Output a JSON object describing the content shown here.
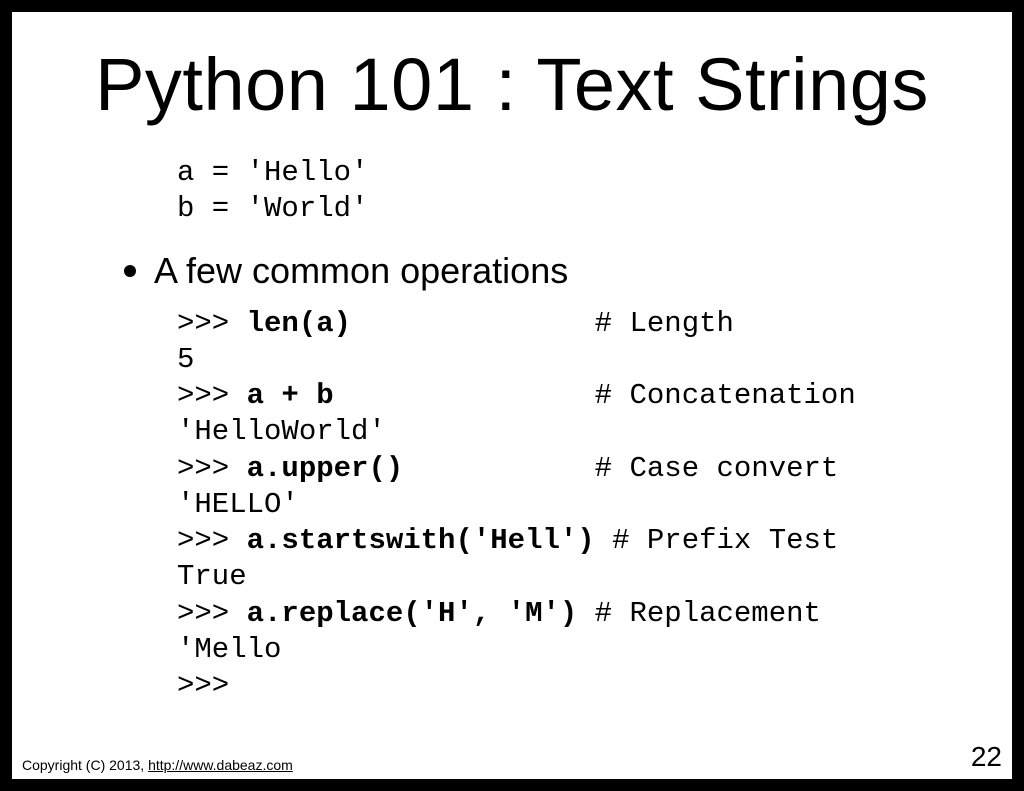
{
  "title": "Python 101 : Text Strings",
  "code_intro": "a = 'Hello'\nb = 'World'",
  "bullet": "A few common operations",
  "lines": [
    {
      "p": ">>> ",
      "b": "len(a)             ",
      "c": " # Length"
    },
    {
      "p": "5",
      "b": "",
      "c": ""
    },
    {
      "p": ">>> ",
      "b": "a + b              ",
      "c": " # Concatenation"
    },
    {
      "p": "'HelloWorld'",
      "b": "",
      "c": ""
    },
    {
      "p": ">>> ",
      "b": "a.upper()          ",
      "c": " # Case convert"
    },
    {
      "p": "'HELLO'",
      "b": "",
      "c": ""
    },
    {
      "p": ">>> ",
      "b": "a.startswith('Hell')",
      "c": " # Prefix Test"
    },
    {
      "p": "True",
      "b": "",
      "c": ""
    },
    {
      "p": ">>> ",
      "b": "a.replace('H', 'M')",
      "c": " # Replacement"
    },
    {
      "p": "'Mello",
      "b": "",
      "c": ""
    },
    {
      "p": ">>>",
      "b": "",
      "c": ""
    }
  ],
  "footer": {
    "copyright_prefix": "Copyright (C) 2013,  ",
    "copyright_link": "http://www.dabeaz.com",
    "page_number": "22"
  }
}
